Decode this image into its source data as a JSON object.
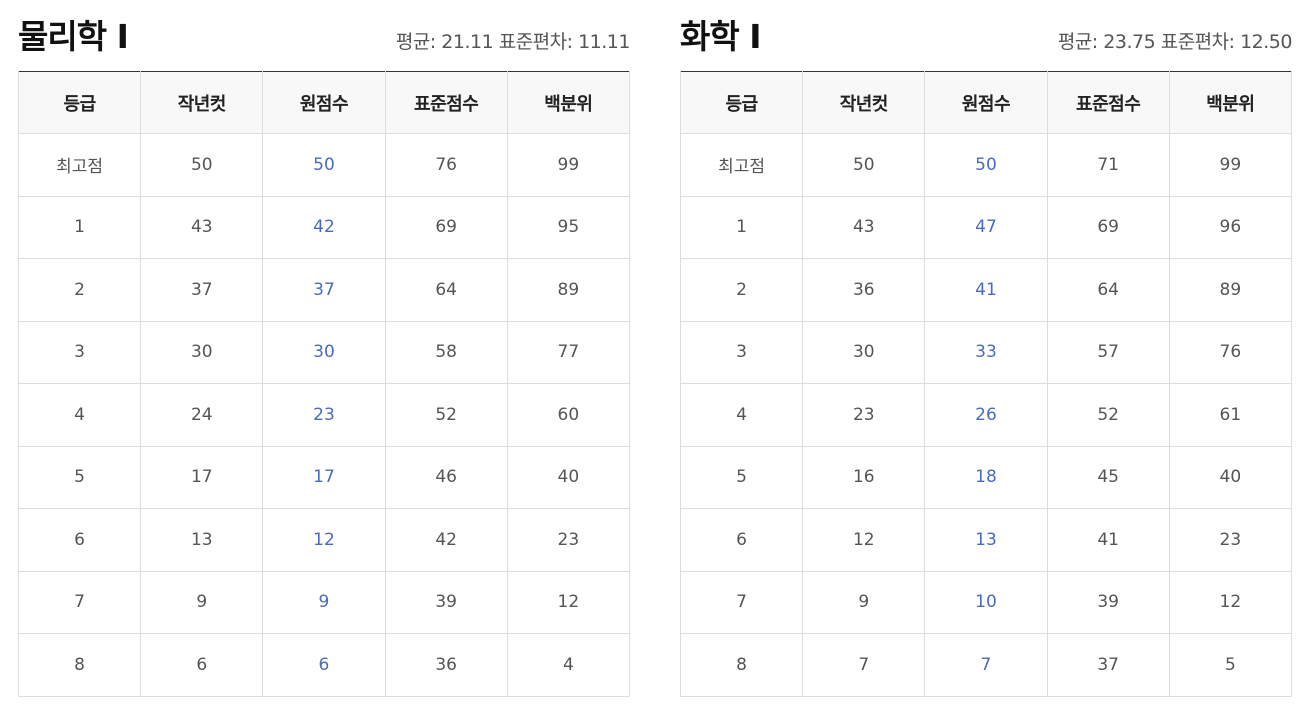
{
  "columns": [
    "등급",
    "작년컷",
    "원점수",
    "표준점수",
    "백분위"
  ],
  "accent_color": "#4a6bbd",
  "panels": [
    {
      "title": "물리학 I",
      "mean_label": "평균:",
      "mean": "21.11",
      "sd_label": "표준편차:",
      "sd": "11.11",
      "rows": [
        [
          "최고점",
          "50",
          "50",
          "76",
          "99"
        ],
        [
          "1",
          "43",
          "42",
          "69",
          "95"
        ],
        [
          "2",
          "37",
          "37",
          "64",
          "89"
        ],
        [
          "3",
          "30",
          "30",
          "58",
          "77"
        ],
        [
          "4",
          "24",
          "23",
          "52",
          "60"
        ],
        [
          "5",
          "17",
          "17",
          "46",
          "40"
        ],
        [
          "6",
          "13",
          "12",
          "42",
          "23"
        ],
        [
          "7",
          "9",
          "9",
          "39",
          "12"
        ],
        [
          "8",
          "6",
          "6",
          "36",
          "4"
        ]
      ]
    },
    {
      "title": "화학 I",
      "mean_label": "평균:",
      "mean": "23.75",
      "sd_label": "표준편차:",
      "sd": "12.50",
      "rows": [
        [
          "최고점",
          "50",
          "50",
          "71",
          "99"
        ],
        [
          "1",
          "43",
          "47",
          "69",
          "96"
        ],
        [
          "2",
          "36",
          "41",
          "64",
          "89"
        ],
        [
          "3",
          "30",
          "33",
          "57",
          "76"
        ],
        [
          "4",
          "23",
          "26",
          "52",
          "61"
        ],
        [
          "5",
          "16",
          "18",
          "45",
          "40"
        ],
        [
          "6",
          "12",
          "13",
          "41",
          "23"
        ],
        [
          "7",
          "9",
          "10",
          "39",
          "12"
        ],
        [
          "8",
          "7",
          "7",
          "37",
          "5"
        ]
      ]
    }
  ]
}
